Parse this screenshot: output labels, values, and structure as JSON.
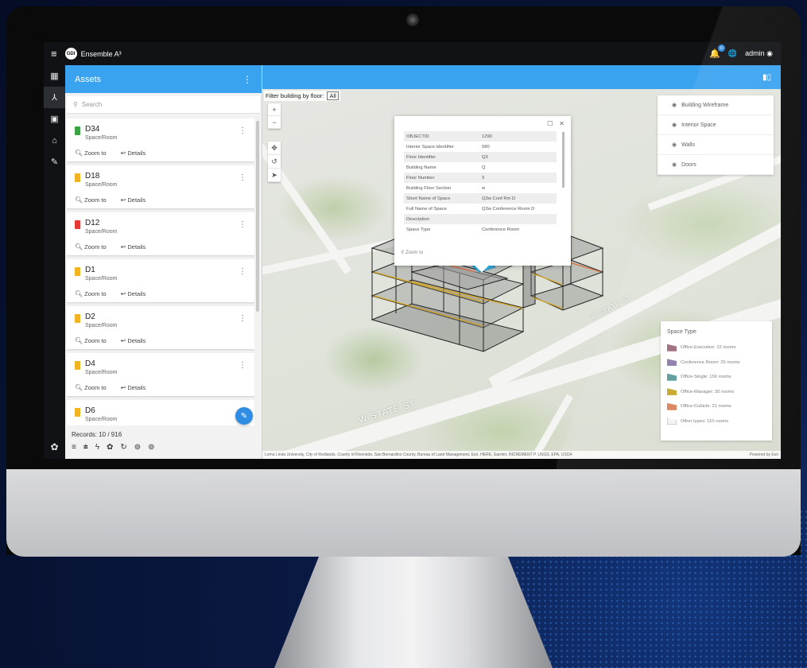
{
  "app": {
    "title": "Ensemble A³",
    "logo_text": "GDI",
    "user": "admin",
    "notifications": "0"
  },
  "panel": {
    "title": "Assets",
    "search_placeholder": "Search",
    "records": "Records: 10 / 916"
  },
  "actions": {
    "zoom": "Zoom to",
    "details": "Details"
  },
  "assets": [
    {
      "name": "D34",
      "type": "Space/Room",
      "color": "#3aa545"
    },
    {
      "name": "D18",
      "type": "Space/Room",
      "color": "#f2b320"
    },
    {
      "name": "D12",
      "type": "Space/Room",
      "color": "#e53935"
    },
    {
      "name": "D1",
      "type": "Space/Room",
      "color": "#f2b320"
    },
    {
      "name": "D2",
      "type": "Space/Room",
      "color": "#f2b320"
    },
    {
      "name": "D4",
      "type": "Space/Room",
      "color": "#f2b320"
    },
    {
      "name": "D6",
      "type": "Space/Room",
      "color": "#f2b320"
    }
  ],
  "map": {
    "filter_label": "Filter building by floor:",
    "filter_value": "All",
    "streets": [
      "W STATE ST",
      "W STATE ST"
    ],
    "attribution": "Loma Linda University, City of Redlands, County of Riverside, San Bernardino County, Bureau of Land Management, Esri, HERE, Garmin, INCREMENT P, USGS, EPA, USDA",
    "powered": "Powered by Esri"
  },
  "popup": {
    "rows": [
      [
        "OBJECTID",
        "1290"
      ],
      [
        "Interior Space Identifier",
        "580"
      ],
      [
        "Floor Identifier",
        "Q3"
      ],
      [
        "Building Name",
        "Q"
      ],
      [
        "Floor Number",
        "3"
      ],
      [
        "Building Floor Section",
        "w"
      ],
      [
        "Short Name of Space",
        "Q3w Conf Rm D"
      ],
      [
        "Full Name of Space",
        "Q3w Conference Room D"
      ],
      [
        "Description",
        ""
      ],
      [
        "Space Type",
        "Conference Room"
      ]
    ],
    "zoom_label": "Zoom to"
  },
  "layers": [
    "Building Wireframe",
    "Interior Space",
    "Walls",
    "Doors"
  ],
  "legend": {
    "title": "Space Type",
    "items": [
      {
        "label": "Office-Executive: 12 rooms",
        "color": "#9c6a7a"
      },
      {
        "label": "Conference Room: 25 rooms",
        "color": "#8c7aa8"
      },
      {
        "label": "Office-Single: 156 rooms",
        "color": "#5a9a9a"
      },
      {
        "label": "Office-Manager: 30 rooms",
        "color": "#c7a82a"
      },
      {
        "label": "Office-Cubicle: 21 rooms",
        "color": "#d9805a"
      },
      {
        "label": "Other types: 110 rooms",
        "color": "#f4f4f4"
      }
    ]
  }
}
